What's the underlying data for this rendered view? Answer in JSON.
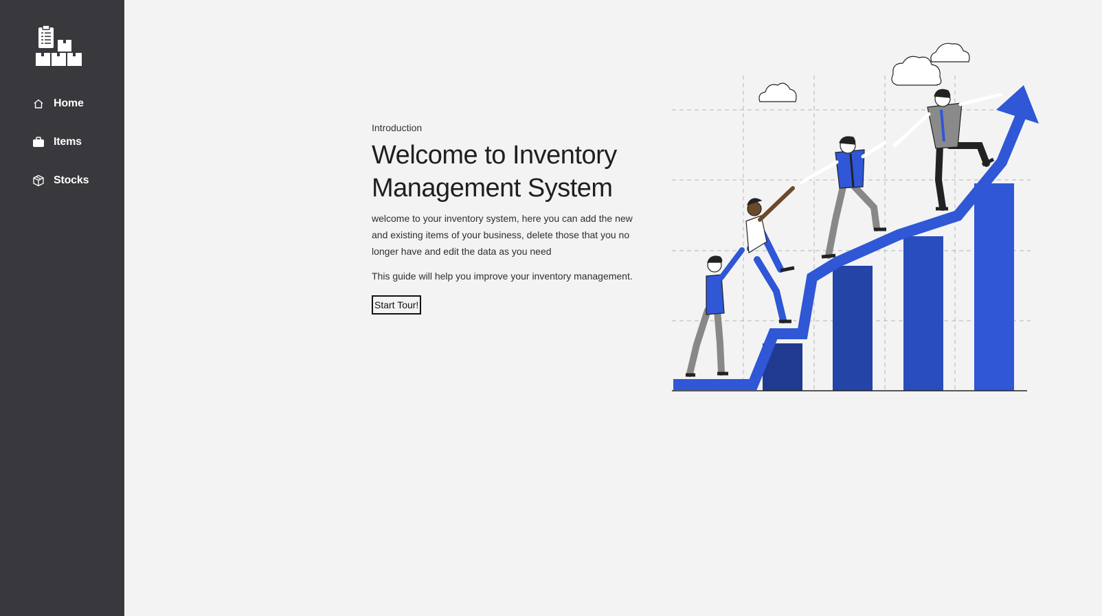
{
  "sidebar": {
    "logo_icon": "inventory-boxes-clipboard-icon",
    "items": [
      {
        "label": "Home",
        "icon": "home-icon"
      },
      {
        "label": "Items",
        "icon": "briefcase-icon"
      },
      {
        "label": "Stocks",
        "icon": "box-icon"
      }
    ]
  },
  "intro": {
    "eyebrow": "Introduction",
    "title": "Welcome to Inventory Management System",
    "description": "welcome to your inventory system, here you can add the new and existing items of your business, delete those that you no longer have and edit the data as you need",
    "guide": "This guide will help you improve your inventory management.",
    "button_label": "Start Tour!"
  },
  "colors": {
    "sidebar_bg": "#39383d",
    "page_bg": "#f3f3f3",
    "accent_blue": "#2f57d6",
    "dark_blue": "#1f3a96"
  }
}
